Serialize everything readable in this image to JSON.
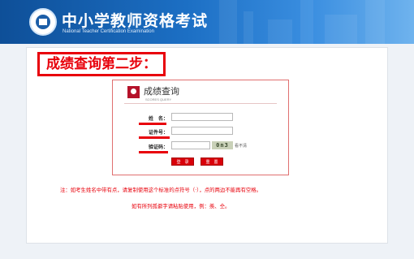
{
  "header": {
    "title": "中小学教师资格考试",
    "subtitle": "National Teacher Certification Examination"
  },
  "step_title": "成绩查询第二步：",
  "query_box": {
    "title": "成绩查询",
    "subtitle": "SCORES QUERY",
    "fields": {
      "name_label": "姓　名：",
      "id_label": "证件号：",
      "captcha_label": "验证码：",
      "name_value": "",
      "id_value": "",
      "captcha_value": ""
    },
    "captcha_text": "0n3",
    "refresh_text": "看不清",
    "login_button": "登　录",
    "reset_button": "重　置"
  },
  "notes": {
    "line1": "注：如考生姓名中带有点，请复制使用这个标准的点符号（·），点的两边不能再有空格。",
    "line2": "如有所列孤僻字请粘贴使用，例：羨、仝。"
  },
  "colors": {
    "accent_red": "#e8000b",
    "header_blue": "#1c6fc4"
  }
}
